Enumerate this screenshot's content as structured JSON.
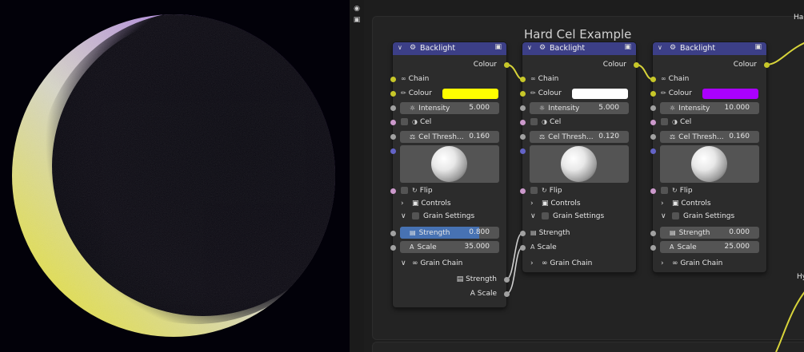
{
  "frame_title": "Hard Cel Example",
  "offscreen": {
    "right_label_1": "Har",
    "right_label_2": "Hy"
  },
  "toolbar": {
    "icon1": "camera-icon",
    "icon2": "lock-icon"
  },
  "nodes": [
    {
      "title": "Backlight",
      "colour_out": "Colour",
      "chain": "Chain",
      "colour": "Colour",
      "colour_value": "#ffff00",
      "intensity_label": "Intensity",
      "intensity": "5.000",
      "cel_label": "Cel",
      "cel_thresh_label": "Cel Thresh...",
      "cel_thresh": "0.160",
      "flip_label": "Flip",
      "controls_label": "Controls",
      "grain_settings_label": "Grain Settings",
      "strength_label": "Strength",
      "strength": "0.800",
      "strength_fill": 0.8,
      "scale_label": "Scale",
      "scale": "35.000",
      "grain_chain_label": "Grain Chain",
      "grain_chain_strength": "Strength",
      "grain_chain_scale": "Scale"
    },
    {
      "title": "Backlight",
      "colour_out": "Colour",
      "chain": "Chain",
      "colour": "Colour",
      "colour_value": "#ffffff",
      "intensity_label": "Intensity",
      "intensity": "5.000",
      "cel_label": "Cel",
      "cel_thresh_label": "Cel Thresh...",
      "cel_thresh": "0.120",
      "flip_label": "Flip",
      "controls_label": "Controls",
      "grain_settings_label": "Grain Settings",
      "strength_label": "Strength",
      "scale_label": "Scale",
      "grain_chain_label": "Grain Chain"
    },
    {
      "title": "Backlight",
      "colour_out": "Colour",
      "chain": "Chain",
      "colour": "Colour",
      "colour_value": "#aa00ff",
      "intensity_label": "Intensity",
      "intensity": "10.000",
      "cel_label": "Cel",
      "cel_thresh_label": "Cel Thresh...",
      "cel_thresh": "0.160",
      "flip_label": "Flip",
      "controls_label": "Controls",
      "grain_settings_label": "Grain Settings",
      "strength_label": "Strength",
      "strength": "0.000",
      "scale_label": "Scale",
      "scale": "25.000",
      "grain_chain_label": "Grain Chain"
    }
  ],
  "colors": {
    "header": "#3c3f87",
    "socket_colour": "#c7c729",
    "socket_float": "#a1a1a1",
    "socket_bool": "#cc99cc",
    "socket_vector": "#6363c7",
    "slider_fill": "#4772b3",
    "link": "#d8d43a"
  }
}
